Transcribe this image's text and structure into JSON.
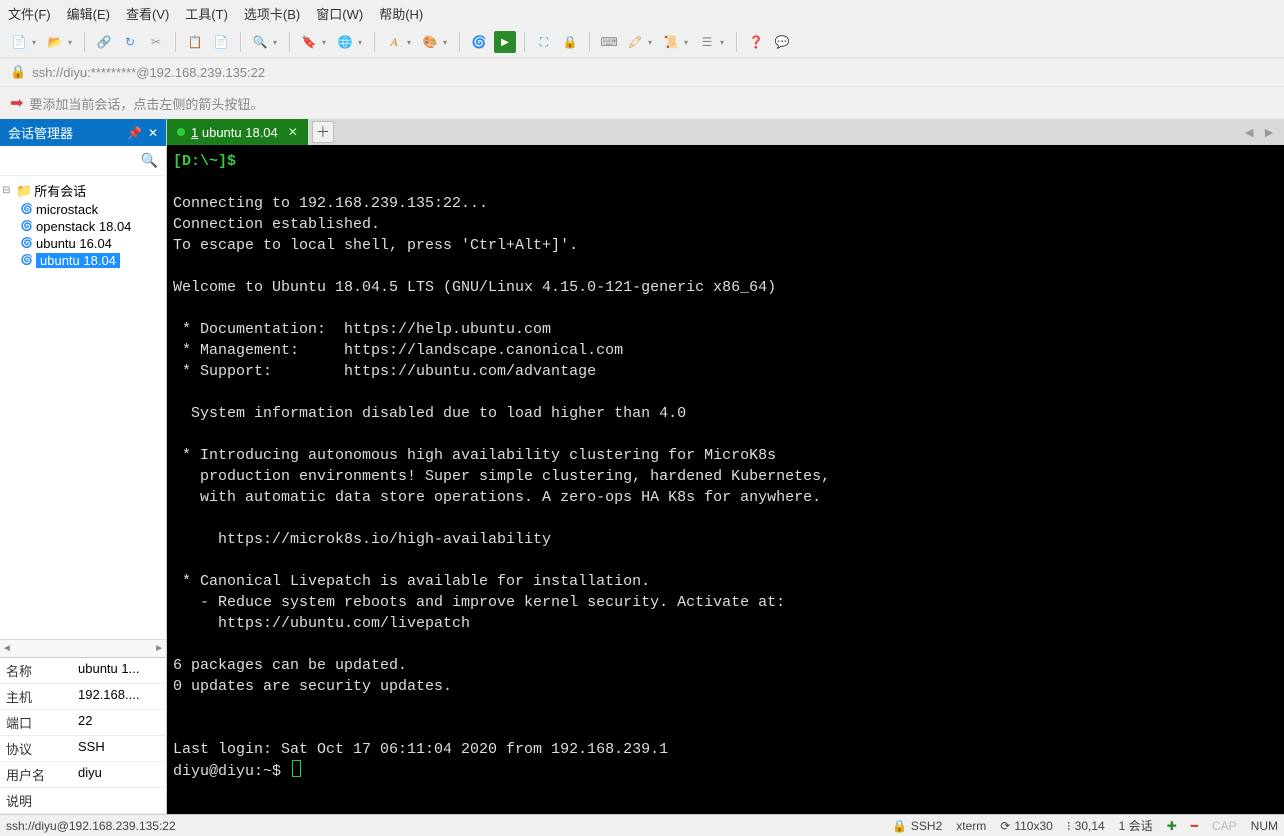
{
  "menu": {
    "file": "文件(F)",
    "edit": "编辑(E)",
    "view": "查看(V)",
    "tools": "工具(T)",
    "tabs": "选项卡(B)",
    "window": "窗口(W)",
    "help": "帮助(H)"
  },
  "addressbar": {
    "url": "ssh://diyu:*********@192.168.239.135:22"
  },
  "hintbar": {
    "text": "要添加当前会话，点击左侧的箭头按钮。"
  },
  "sidebar": {
    "title": "会话管理器",
    "root_label": "所有会话",
    "sessions": [
      {
        "label": "microstack"
      },
      {
        "label": "openstack 18.04"
      },
      {
        "label": "ubuntu 16.04"
      },
      {
        "label": "ubuntu 18.04",
        "selected": true
      }
    ]
  },
  "props": [
    {
      "k": "名称",
      "v": "ubuntu 1..."
    },
    {
      "k": "主机",
      "v": "192.168...."
    },
    {
      "k": "端口",
      "v": "22"
    },
    {
      "k": "协议",
      "v": "SSH"
    },
    {
      "k": "用户名",
      "v": "diyu"
    },
    {
      "k": "说明",
      "v": ""
    }
  ],
  "tab": {
    "index": "1",
    "label": "ubuntu 18.04"
  },
  "terminal": {
    "prompt_bracket_open": "[D:\\~]$",
    "lines": [
      "",
      "Connecting to 192.168.239.135:22...",
      "Connection established.",
      "To escape to local shell, press 'Ctrl+Alt+]'.",
      "",
      "Welcome to Ubuntu 18.04.5 LTS (GNU/Linux 4.15.0-121-generic x86_64)",
      "",
      " * Documentation:  https://help.ubuntu.com",
      " * Management:     https://landscape.canonical.com",
      " * Support:        https://ubuntu.com/advantage",
      "",
      "  System information disabled due to load higher than 4.0",
      "",
      " * Introducing autonomous high availability clustering for MicroK8s",
      "   production environments! Super simple clustering, hardened Kubernetes,",
      "   with automatic data store operations. A zero-ops HA K8s for anywhere.",
      "",
      "     https://microk8s.io/high-availability",
      "",
      " * Canonical Livepatch is available for installation.",
      "   - Reduce system reboots and improve kernel security. Activate at:",
      "     https://ubuntu.com/livepatch",
      "",
      "6 packages can be updated.",
      "0 updates are security updates.",
      "",
      "",
      "Last login: Sat Oct 17 06:11:04 2020 from 192.168.239.1"
    ],
    "final_prompt": "diyu@diyu:~$ "
  },
  "status": {
    "left": "ssh://diyu@192.168.239.135:22",
    "ssh": "SSH2",
    "term": "xterm",
    "size": "110x30",
    "pos": "30,14",
    "sessions": "1 会话",
    "cap": "CAP",
    "num": "NUM"
  }
}
